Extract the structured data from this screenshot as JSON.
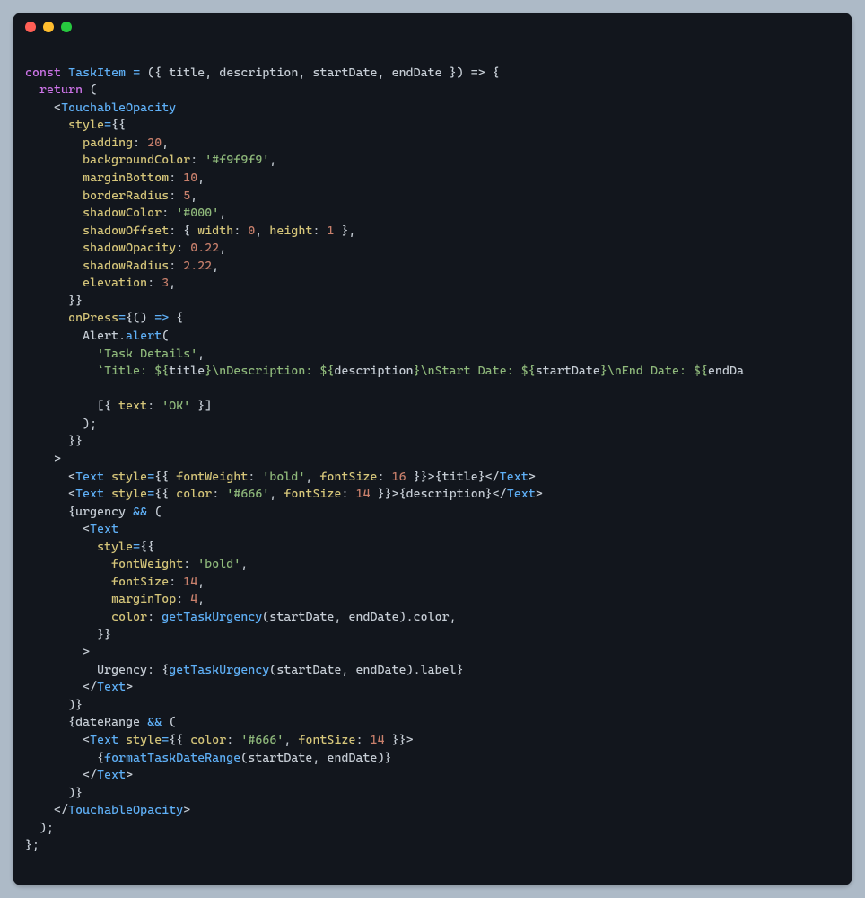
{
  "window": {
    "traffic_lights": [
      "close",
      "minimize",
      "zoom"
    ]
  },
  "code": {
    "l01": {
      "kw": "const",
      "name": "TaskItem",
      "params": [
        "title",
        "description",
        "startDate",
        "endDate"
      ]
    },
    "l01_tail": " }) => {",
    "l02": "  return (",
    "l03": "    <TouchableOpacity",
    "l04_attr": "style",
    "l05": {
      "key": "padding",
      "val": "20"
    },
    "l06": {
      "key": "backgroundColor",
      "val": "'#f9f9f9'"
    },
    "l07": {
      "key": "marginBottom",
      "val": "10"
    },
    "l08": {
      "key": "borderRadius",
      "val": "5"
    },
    "l09": {
      "key": "shadowColor",
      "val": "'#000'"
    },
    "l10": {
      "key": "shadowOffset",
      "w": "width",
      "wval": "0",
      "h": "height",
      "hval": "1"
    },
    "l11": {
      "key": "shadowOpacity",
      "val": "0.22"
    },
    "l12": {
      "key": "shadowRadius",
      "val": "2.22"
    },
    "l13": {
      "key": "elevation",
      "val": "3"
    },
    "l14": "      }}",
    "l15_attr": "onPress",
    "l16": {
      "obj": "Alert",
      "method": "alert"
    },
    "l17": "'Task Details'",
    "l18_a": "`Title: ${",
    "l18_v1": "title",
    "l18_b": "}\\nDescription: ${",
    "l18_v2": "description",
    "l18_c": "}\\nStart Date: ${",
    "l18_v3": "startDate",
    "l18_d": "}\\nEnd Date: ${",
    "l18_v4": "endDa",
    "l20": {
      "key": "text",
      "val": "'OK'"
    },
    "tag_text": "Text",
    "attr_style": "style",
    "fw": "fontWeight",
    "fw_val": "'bold'",
    "fs": "fontSize",
    "fs16": "16",
    "fs14": "14",
    "color_key": "color",
    "color_val": "'#666'",
    "title_var": "title",
    "desc_var": "description",
    "urgency": "urgency",
    "mt": "marginTop",
    "mt_val": "4",
    "getUrg": "getTaskUrgency",
    "sd": "startDate",
    "ed": "endDate",
    "colorprop": "color",
    "labelprop": "label",
    "urg_text": "Urgency: ",
    "dateRange": "dateRange",
    "fmt": "formatTaskDateRange",
    "tOpacity": "TouchableOpacity"
  }
}
